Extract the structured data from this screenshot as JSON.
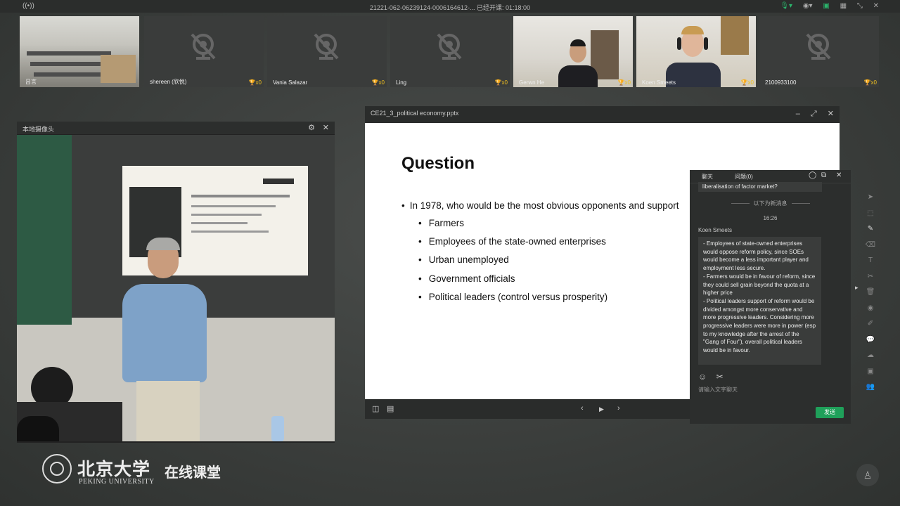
{
  "topbar": {
    "title": "21221-062-06239124-0006164612-...    已经开课: 01:18:00"
  },
  "participants": [
    {
      "name": "吕言",
      "cup": "",
      "camera": "on"
    },
    {
      "name": "shereen (欣悦)",
      "cup": "x0",
      "camera": "off"
    },
    {
      "name": "Vania Salazar",
      "cup": "x0",
      "camera": "off"
    },
    {
      "name": "Ling",
      "cup": "x0",
      "camera": "off"
    },
    {
      "name": "Gerwn He",
      "cup": "x0",
      "camera": "on"
    },
    {
      "name": "Koen Smeets",
      "cup": "x0",
      "camera": "on"
    },
    {
      "name": "2100933100",
      "cup": "x0",
      "camera": "off"
    }
  ],
  "localcam": {
    "title": "本地摄像头"
  },
  "ppt": {
    "title": "CE21_3_political economy.pptx",
    "slide": {
      "heading": "Question",
      "question": "In 1978, who would be the most obvious opponents and support",
      "items": [
        "Farmers",
        "Employees of the state-owned enterprises",
        "Urban unemployed",
        "Government officials",
        "Political leaders (control versus prosperity)"
      ]
    }
  },
  "chat": {
    "tab_chat": "聊天",
    "tab_question": "问题(0)",
    "prev_message": "liberalisation of factor market?",
    "new_message_divider": "以下为新消息",
    "time": "16:26",
    "sender": "Koen Smeets",
    "message_lines": [
      "- Employees of state-owned enterprises would oppose reform policy, since SOEs would become a less important player and employment less secure.",
      "- Farmers would be in favour of reform, since they could sell grain beyond the quota at a higher price",
      "- Political leaders support of reform would be divided amongst more conservative and more progressive leaders. Considering more progressive leaders were more in power (esp to my knowledge after the arrest of the \"Gang of Four\"), overall political leaders would be in favour."
    ],
    "input_placeholder": "请输入文字聊天",
    "send_label": "发送"
  },
  "logo": {
    "cn": "北京大学",
    "en": "PEKING UNIVERSITY",
    "online": "在线课堂"
  }
}
